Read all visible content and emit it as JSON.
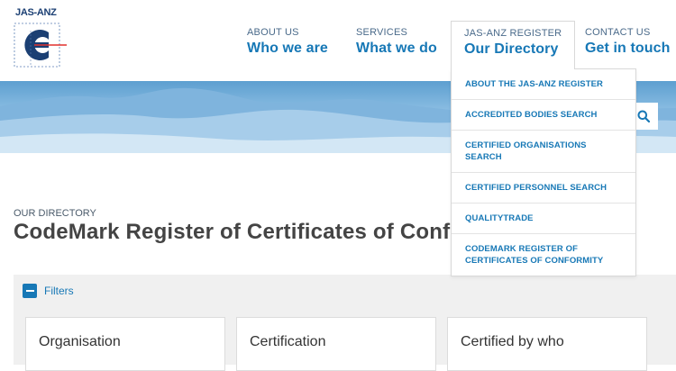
{
  "logo": {
    "text": "JAS-ANZ"
  },
  "nav": [
    {
      "small": "ABOUT US",
      "big": "Who we are"
    },
    {
      "small": "SERVICES",
      "big": "What we do"
    },
    {
      "small": "JAS-ANZ REGISTER",
      "big": "Our Directory"
    },
    {
      "small": "CONTACT US",
      "big": "Get in touch"
    }
  ],
  "dropdown": [
    "ABOUT THE JAS-ANZ REGISTER",
    "ACCREDITED BODIES SEARCH",
    "CERTIFIED ORGANISATIONS SEARCH",
    "CERTIFIED PERSONNEL SEARCH",
    "QUALITYTRADE",
    "CODEMARK REGISTER OF CERTIFICATES OF CONFORMITY"
  ],
  "page": {
    "breadcrumb": "OUR DIRECTORY",
    "title": "CodeMark Register of Certificates of Conformity"
  },
  "filters": {
    "label": "Filters",
    "cards": [
      "Organisation",
      "Certification",
      "Certified by who"
    ]
  },
  "colors": {
    "accent": "#1778b6",
    "brand": "#1b3f73",
    "logo_red": "#e2312d"
  },
  "icons": {
    "search": "search-icon",
    "collapse": "minus-icon"
  }
}
